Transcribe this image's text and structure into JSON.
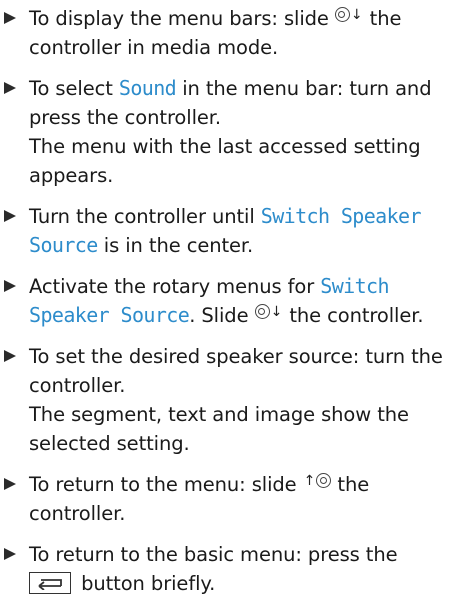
{
  "steps": [
    {
      "pre": "To display the menu bars: slide ",
      "post": " the controller in media mode."
    },
    {
      "pre": "To select ",
      "highlight": "Sound",
      "post": " in the menu bar: turn and press the controller.",
      "result": "The menu with the last accessed setting appears."
    },
    {
      "pre": "Turn the controller until ",
      "highlight": "Switch Speaker Source",
      "post": " is in the center."
    },
    {
      "pre": "Activate the rotary menus for ",
      "highlight": "Switch Speaker Source",
      "mid": ". Slide ",
      "post": " the controller."
    },
    {
      "pre": "To set the desired speaker source: turn the controller.",
      "result": "The segment, text and image show the selected setting."
    },
    {
      "pre": "To return to the menu: slide ",
      "post": " the controller."
    },
    {
      "pre": "To return to the basic menu: press the",
      "post": " button briefly."
    }
  ],
  "icons": {
    "down_arrow": "↓",
    "up_arrow": "↑"
  },
  "colors": {
    "highlight": "#2d8ccb",
    "text": "#1a1a1a"
  }
}
